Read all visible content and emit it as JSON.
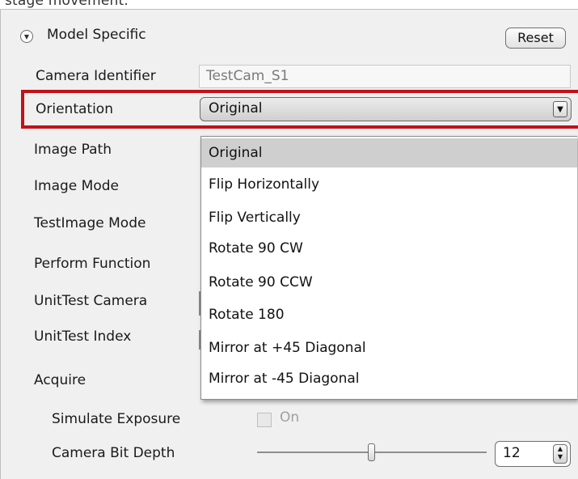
{
  "top_text": "stage movement.",
  "section": {
    "title": "Model Specific",
    "reset_label": "Reset"
  },
  "fields": {
    "camera_identifier": {
      "label": "Camera Identifier",
      "value": "TestCam_S1"
    },
    "orientation": {
      "label": "Orientation",
      "value": "Original"
    },
    "image_path": {
      "label": "Image Path"
    },
    "image_mode": {
      "label": "Image Mode"
    },
    "testimage_mode": {
      "label": "TestImage Mode"
    },
    "perform_function": {
      "label": "Perform Function"
    },
    "unittest_camera": {
      "label": "UnitTest Camera"
    },
    "unittest_index": {
      "label": "UnitTest Index"
    },
    "acquire": {
      "label": "Acquire"
    },
    "simulate_exposure": {
      "label": "Simulate Exposure",
      "check_label": "On",
      "checked": false
    },
    "camera_bit_depth": {
      "label": "Camera Bit Depth",
      "value": "12"
    }
  },
  "dropdown": {
    "options": [
      "Original",
      "Flip Horizontally",
      "Flip Vertically",
      "Rotate 90 CW",
      "Rotate 90 CCW",
      "Rotate 180",
      "Mirror at +45 Diagonal",
      "Mirror at -45 Diagonal"
    ],
    "selected_index": 0
  },
  "colors": {
    "highlight": "#c0121a",
    "selected_bg": "#cfcfcf",
    "panel_bg": "#f0f0f0"
  },
  "icons": {
    "section_toggle": "chevron-down-circle-icon",
    "combo_arrow": "triangle-down-icon",
    "spin": "up-down-arrows-icon"
  }
}
